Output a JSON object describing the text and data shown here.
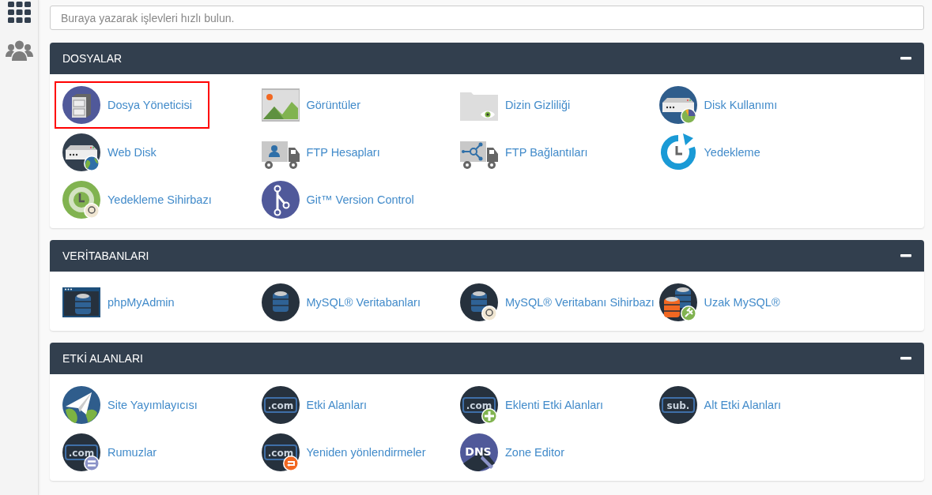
{
  "search": {
    "placeholder": "Buraya yazarak işlevleri hızlı bulun."
  },
  "panels": [
    {
      "title": "DOSYALAR",
      "expanded": true,
      "items": [
        {
          "label": "Dosya Yöneticisi",
          "kind": "file-manager",
          "highlighted": true
        },
        {
          "label": "Görüntüler",
          "kind": "images",
          "highlighted": false
        },
        {
          "label": "Dizin Gizliliği",
          "kind": "dir-privacy",
          "highlighted": false
        },
        {
          "label": "Disk Kullanımı",
          "kind": "disk-usage",
          "highlighted": false
        },
        {
          "label": "Web Disk",
          "kind": "web-disk",
          "highlighted": false
        },
        {
          "label": "FTP Hesapları",
          "kind": "ftp-accounts",
          "highlighted": false
        },
        {
          "label": "FTP Bağlantıları",
          "kind": "ftp-connections",
          "highlighted": false
        },
        {
          "label": "Yedekleme",
          "kind": "backup",
          "highlighted": false
        },
        {
          "label": "Yedekleme Sihirbazı",
          "kind": "backup-wizard",
          "highlighted": false
        },
        {
          "label": "Git™ Version Control",
          "kind": "git",
          "highlighted": false
        }
      ]
    },
    {
      "title": "VERİTABANLARI",
      "expanded": true,
      "items": [
        {
          "label": "phpMyAdmin",
          "kind": "phpmyadmin",
          "highlighted": false
        },
        {
          "label": "MySQL® Veritabanları",
          "kind": "mysql-db",
          "highlighted": false
        },
        {
          "label": "MySQL® Veritabanı Sihirbazı",
          "kind": "mysql-wizard",
          "highlighted": false
        },
        {
          "label": "Uzak MySQL®",
          "kind": "remote-mysql",
          "highlighted": false
        }
      ]
    },
    {
      "title": "ETKİ ALANLARI",
      "expanded": true,
      "items": [
        {
          "label": "Site Yayımlayıcısı",
          "kind": "site-publisher",
          "highlighted": false
        },
        {
          "label": "Etki Alanları",
          "kind": "domains",
          "icon_text": ".com",
          "highlighted": false
        },
        {
          "label": "Eklenti Etki Alanları",
          "kind": "addon-domains",
          "icon_text": ".com",
          "highlighted": false
        },
        {
          "label": "Alt Etki Alanları",
          "kind": "subdomains",
          "icon_text": "sub.",
          "highlighted": false
        },
        {
          "label": "Rumuzlar",
          "kind": "aliases",
          "icon_text": ".com",
          "highlighted": false
        },
        {
          "label": "Yeniden yönlendirmeler",
          "kind": "redirects",
          "icon_text": ".com",
          "highlighted": false
        },
        {
          "label": "Zone Editor",
          "kind": "zone-editor",
          "icon_text": "DNS",
          "highlighted": false
        }
      ]
    }
  ]
}
